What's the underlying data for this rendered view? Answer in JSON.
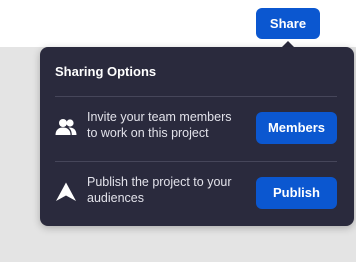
{
  "header": {
    "share_label": "Share"
  },
  "sharing_popover": {
    "title": "Sharing Options",
    "options": [
      {
        "icon": "team-members-icon",
        "text_lines": [
          "Invite your team members",
          "to work on this project"
        ],
        "button_label": "Members"
      },
      {
        "icon": "publish-icon",
        "text_lines": [
          "Publish the project to your",
          "audiences"
        ],
        "button_label": "Publish"
      }
    ]
  },
  "colors": {
    "accent": "#0b57d0",
    "popover_bg": "#2a2a3d",
    "page_bg": "#e4e4e4",
    "topbar_bg": "#ffffff"
  }
}
